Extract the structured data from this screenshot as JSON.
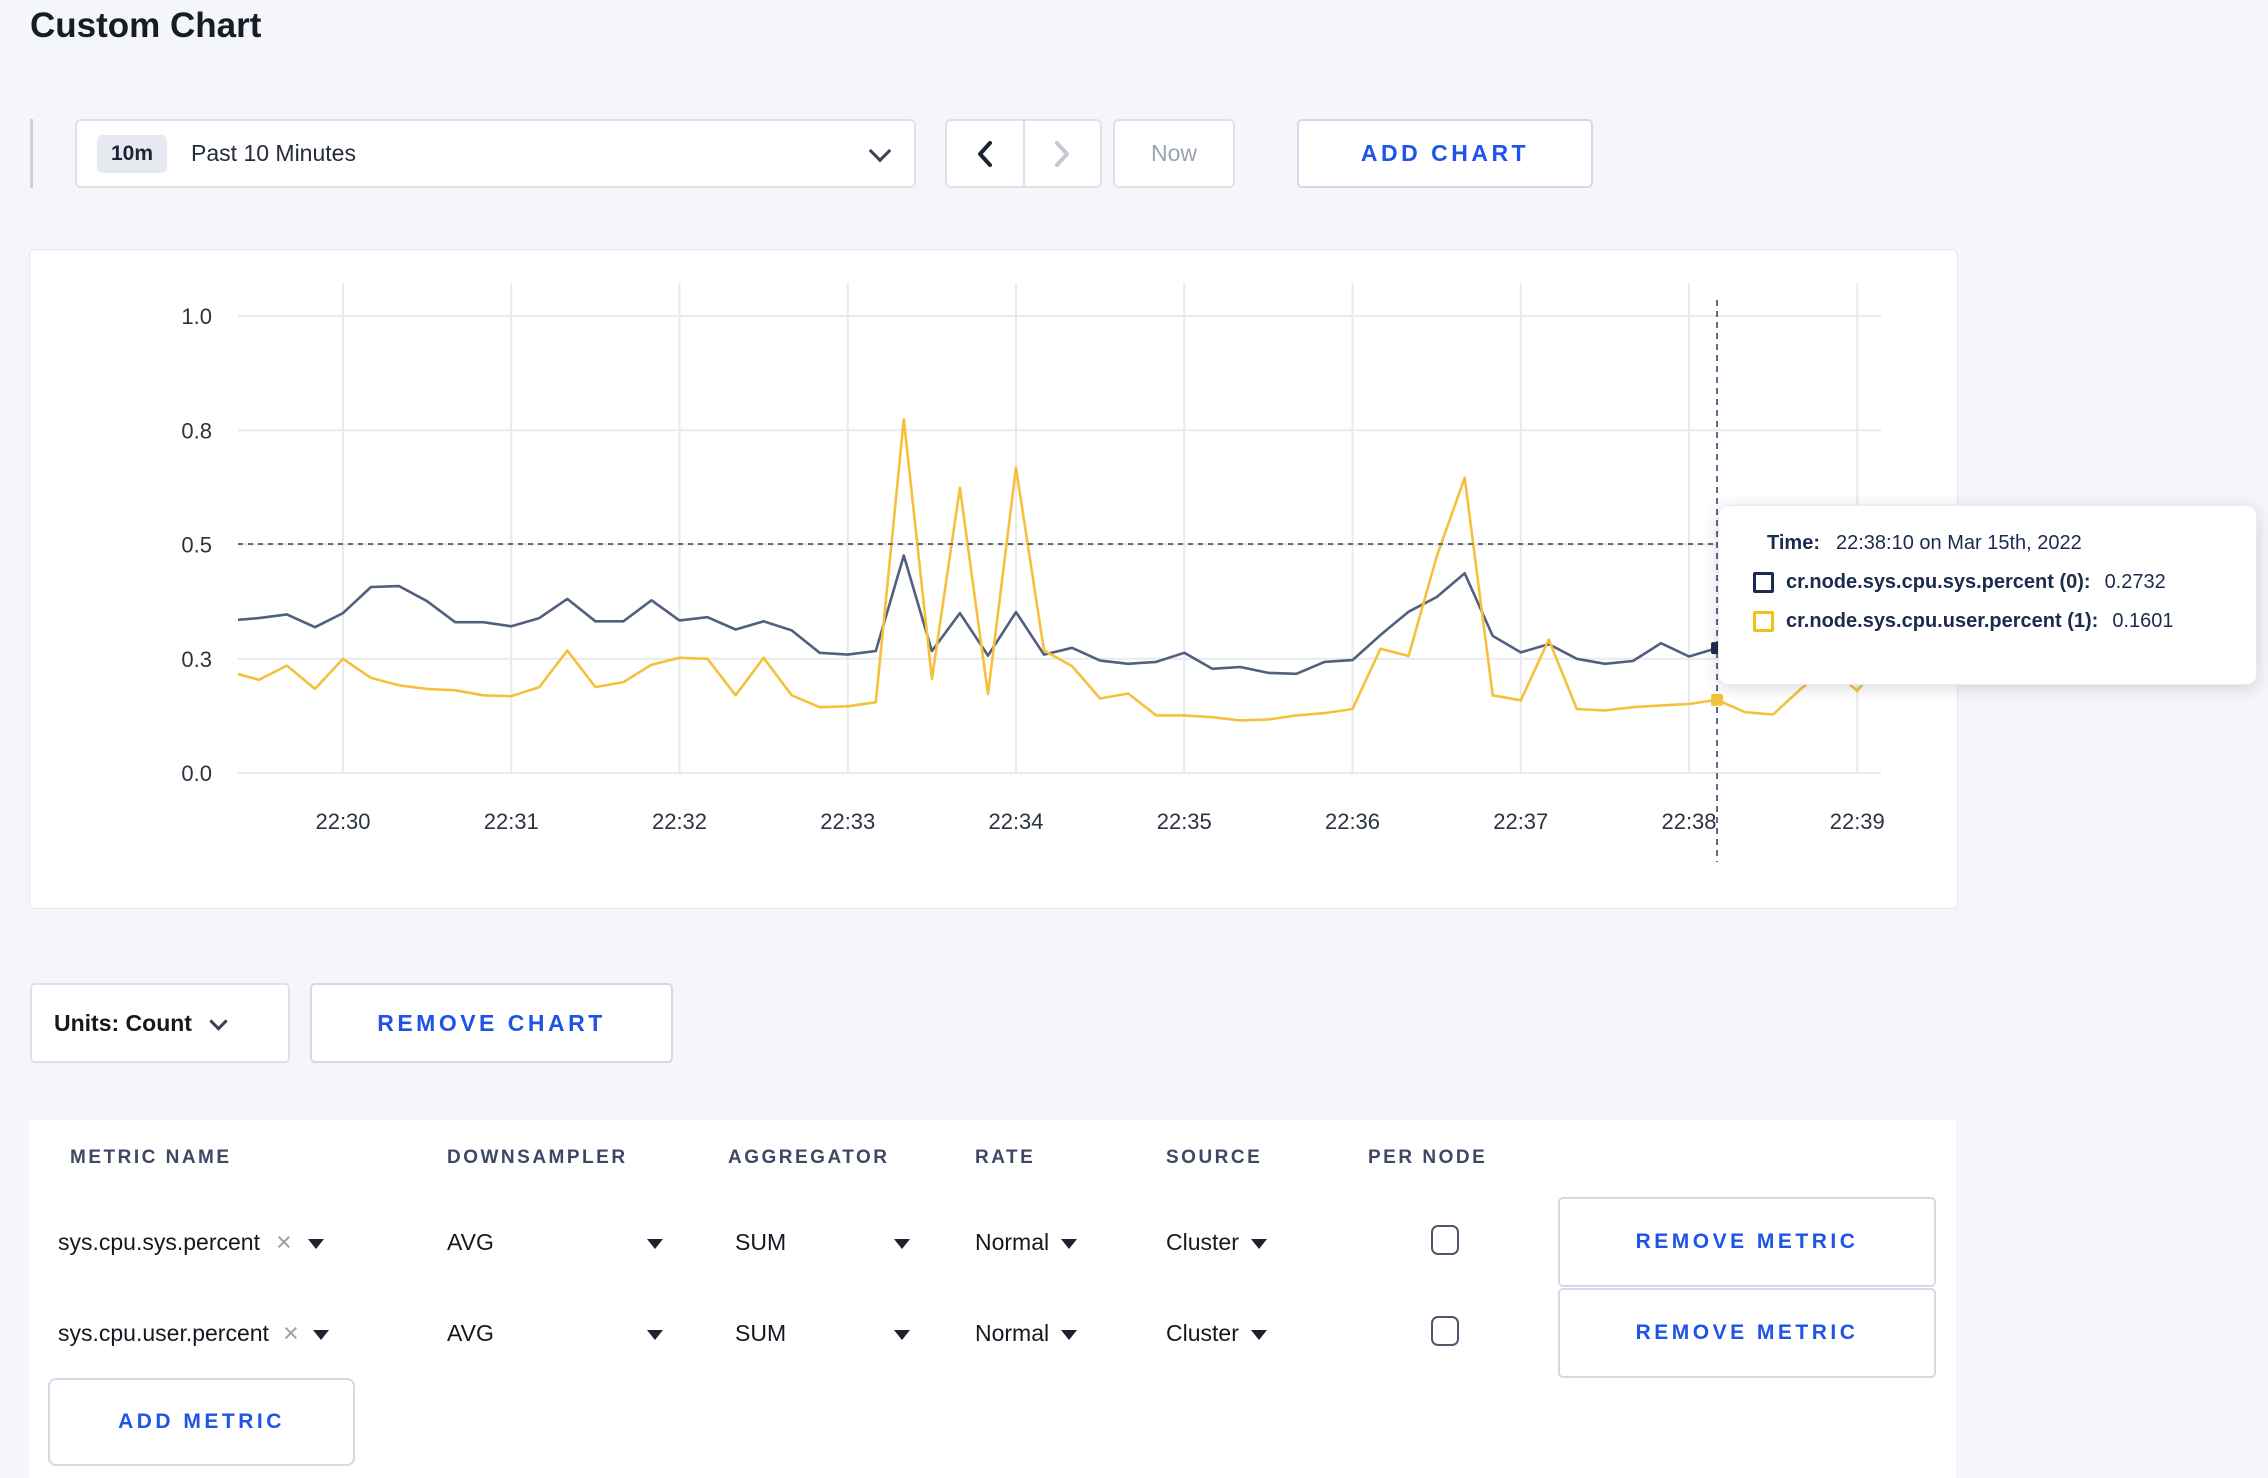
{
  "page": {
    "title": "Custom Chart"
  },
  "colors": {
    "accent_blue": "#1e54e8",
    "sys_line": "#51607f",
    "user_line": "#f6c13a",
    "sys_swatch": "#1c2b4d",
    "user_swatch": "#f5bf17",
    "crosshair": "#5a6a85",
    "gridline": "#e9eaee",
    "axis_text": "#2c3340"
  },
  "toolbar": {
    "time_badge": "10m",
    "time_range_label": "Past 10 Minutes",
    "now_label": "Now",
    "add_chart_label": "ADD CHART",
    "icons": {
      "time_dropdown": "chevron-down",
      "prev": "chevron-left",
      "next": "chevron-right"
    }
  },
  "tooltip": {
    "time_label": "Time:",
    "time_value": "22:38:10 on Mar 15th, 2022",
    "entries": [
      {
        "name": "cr.node.sys.cpu.sys.percent (0):",
        "value": "0.2732"
      },
      {
        "name": "cr.node.sys.cpu.user.percent (1):",
        "value": "0.1601"
      }
    ]
  },
  "units_bar": {
    "units_label": "Units: Count",
    "remove_chart_label": "REMOVE CHART"
  },
  "table": {
    "headers": [
      "METRIC NAME",
      "DOWNSAMPLER",
      "AGGREGATOR",
      "RATE",
      "SOURCE",
      "PER NODE"
    ],
    "rows": [
      {
        "metric": "sys.cpu.sys.percent",
        "downsampler": "AVG",
        "aggregator": "SUM",
        "rate": "Normal",
        "source": "Cluster",
        "per_node_checked": false,
        "action": "REMOVE METRIC"
      },
      {
        "metric": "sys.cpu.user.percent",
        "downsampler": "AVG",
        "aggregator": "SUM",
        "rate": "Normal",
        "source": "Cluster",
        "per_node_checked": false,
        "action": "REMOVE METRIC"
      }
    ],
    "add_metric_label": "ADD METRIC",
    "remove_glyph": "×"
  },
  "chart_data": {
    "type": "line",
    "title": "",
    "xlabel": "",
    "ylabel": "",
    "ylim": [
      0,
      1
    ],
    "grid": true,
    "x_tick_labels": [
      "22:30",
      "22:31",
      "22:32",
      "22:33",
      "22:34",
      "22:35",
      "22:36",
      "22:37",
      "22:38",
      "22:39"
    ],
    "y_ticks": [
      {
        "value": 0.0,
        "label": "0.0"
      },
      {
        "value": 0.25,
        "label": "0.3"
      },
      {
        "value": 0.5,
        "label": "0.5"
      },
      {
        "value": 0.75,
        "label": "0.8"
      },
      {
        "value": 1.0,
        "label": "1.0"
      }
    ],
    "x_start_time": "22:29:20",
    "x_step_seconds": 10,
    "series": [
      {
        "name": "cr.node.sys.cpu.sys.percent",
        "values": [
          0.334,
          0.339,
          0.347,
          0.319,
          0.35,
          0.407,
          0.409,
          0.376,
          0.33,
          0.33,
          0.321,
          0.339,
          0.381,
          0.332,
          0.332,
          0.378,
          0.334,
          0.341,
          0.314,
          0.332,
          0.312,
          0.263,
          0.259,
          0.267,
          0.476,
          0.267,
          0.35,
          0.257,
          0.352,
          0.259,
          0.274,
          0.246,
          0.239,
          0.243,
          0.263,
          0.228,
          0.232,
          0.219,
          0.217,
          0.243,
          0.247,
          0.302,
          0.353,
          0.385,
          0.437,
          0.3,
          0.264,
          0.282,
          0.25,
          0.239,
          0.245,
          0.284,
          0.255,
          0.2732,
          0.262,
          0.268,
          0.278,
          0.288,
          0.296,
          0.3
        ]
      },
      {
        "name": "cr.node.sys.cpu.user.percent",
        "values": [
          0.221,
          0.204,
          0.235,
          0.184,
          0.25,
          0.208,
          0.192,
          0.184,
          0.181,
          0.17,
          0.168,
          0.188,
          0.268,
          0.188,
          0.199,
          0.237,
          0.252,
          0.25,
          0.17,
          0.252,
          0.17,
          0.144,
          0.146,
          0.155,
          0.774,
          0.206,
          0.624,
          0.173,
          0.668,
          0.268,
          0.234,
          0.163,
          0.174,
          0.126,
          0.126,
          0.122,
          0.115,
          0.117,
          0.126,
          0.131,
          0.14,
          0.272,
          0.256,
          0.473,
          0.646,
          0.17,
          0.159,
          0.292,
          0.14,
          0.137,
          0.144,
          0.148,
          0.151,
          0.1601,
          0.133,
          0.128,
          0.185,
          0.232,
          0.18,
          0.255
        ]
      }
    ],
    "crosshair": {
      "time": "22:38:10",
      "seconds_from_2230": 490,
      "hover_y_value": 0.501,
      "marker_values": [
        0.2732,
        0.1601
      ]
    },
    "legend_position": "tooltip"
  }
}
